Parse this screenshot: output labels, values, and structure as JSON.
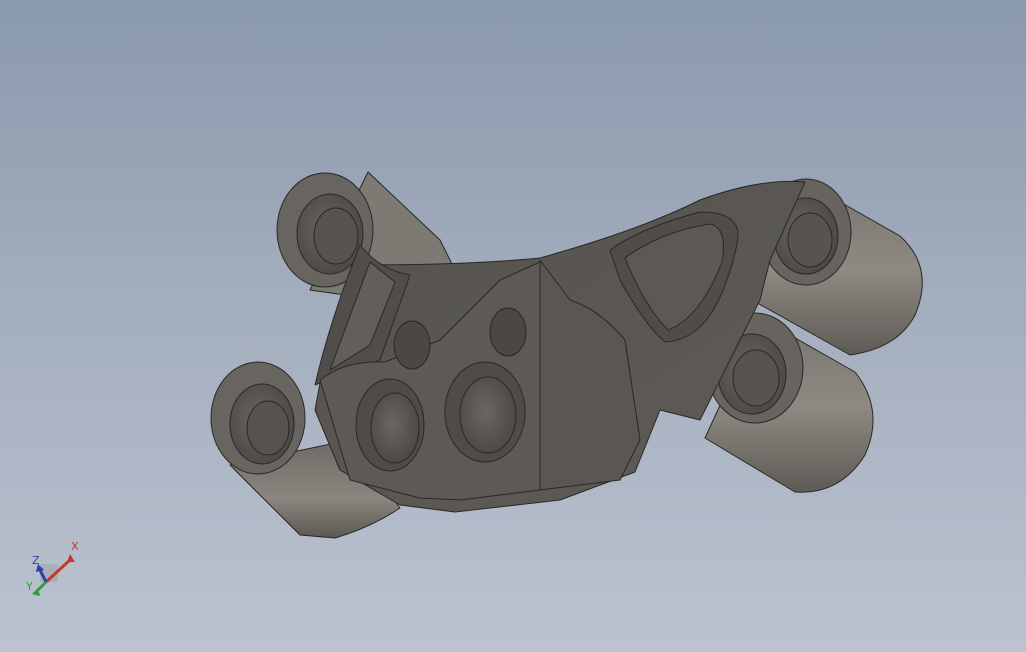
{
  "viewport": {
    "background_top": "#8b99ad",
    "background_bottom": "#bcc3d0",
    "part_color": "#5f5c58"
  },
  "triad": {
    "x_label": "X",
    "y_label": "Y",
    "z_label": "Z",
    "x_color": "#c0392b",
    "y_color": "#2e9e3a",
    "z_color": "#2c3fa8"
  }
}
